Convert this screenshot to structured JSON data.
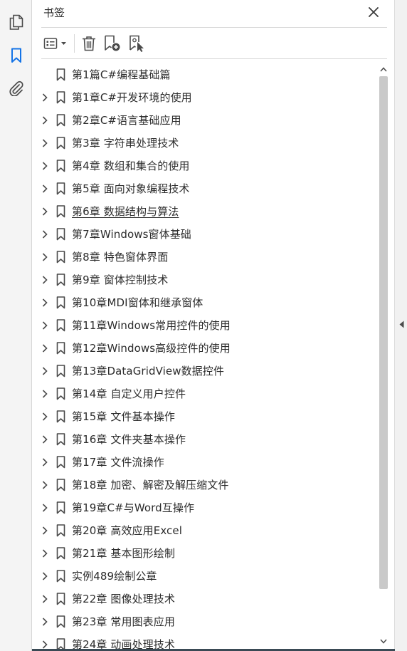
{
  "panel": {
    "title": "书签"
  },
  "rail": {
    "items": [
      {
        "icon": "pages-icon",
        "active": false
      },
      {
        "icon": "bookmark-icon",
        "active": true
      },
      {
        "icon": "attachment-icon",
        "active": false
      }
    ]
  },
  "toolbar": {
    "buttons": [
      "options-menu-icon",
      "delete-icon",
      "new-bookmark-icon",
      "bookmark-from-selection-icon"
    ]
  },
  "colors": {
    "accent": "#1473e6",
    "icon": "#4b4b4b",
    "text": "#2c2c2c"
  },
  "bookmarks": [
    {
      "label": "第1篇C#编程基础篇",
      "expandable": false
    },
    {
      "label": "第1章C#开发环境的使用",
      "expandable": true
    },
    {
      "label": "第2章C#语言基础应用",
      "expandable": true
    },
    {
      "label": "第3章  字符串处理技术",
      "expandable": true
    },
    {
      "label": "第4章  数组和集合的使用",
      "expandable": true
    },
    {
      "label": "第5章  面向对象编程技术",
      "expandable": true
    },
    {
      "label": "第6章  数据结构与算法",
      "expandable": true,
      "hovered": true
    },
    {
      "label": "第7章Windows窗体基础",
      "expandable": true
    },
    {
      "label": "第8章  特色窗体界面",
      "expandable": true
    },
    {
      "label": "第9章  窗体控制技术",
      "expandable": true
    },
    {
      "label": "第10章MDI窗体和继承窗体",
      "expandable": true
    },
    {
      "label": "第11章Windows常用控件的使用",
      "expandable": true
    },
    {
      "label": "第12章Windows高级控件的使用",
      "expandable": true
    },
    {
      "label": "第13章DataGridView数据控件",
      "expandable": true
    },
    {
      "label": "第14章  自定义用户控件",
      "expandable": true
    },
    {
      "label": "第15章  文件基本操作",
      "expandable": true
    },
    {
      "label": "第16章  文件夹基本操作",
      "expandable": true
    },
    {
      "label": "第17章  文件流操作",
      "expandable": true
    },
    {
      "label": "第18章  加密、解密及解压缩文件",
      "expandable": true
    },
    {
      "label": "第19章C#与Word互操作",
      "expandable": true
    },
    {
      "label": "第20章  高效应用Excel",
      "expandable": true
    },
    {
      "label": "第21章  基本图形绘制",
      "expandable": true
    },
    {
      "label": "  实例489绘制公章",
      "expandable": true
    },
    {
      "label": "第22章  图像处理技术",
      "expandable": true
    },
    {
      "label": "第23章  常用图表应用",
      "expandable": true
    },
    {
      "label": "第24章  动画处理技术",
      "expandable": true
    }
  ]
}
